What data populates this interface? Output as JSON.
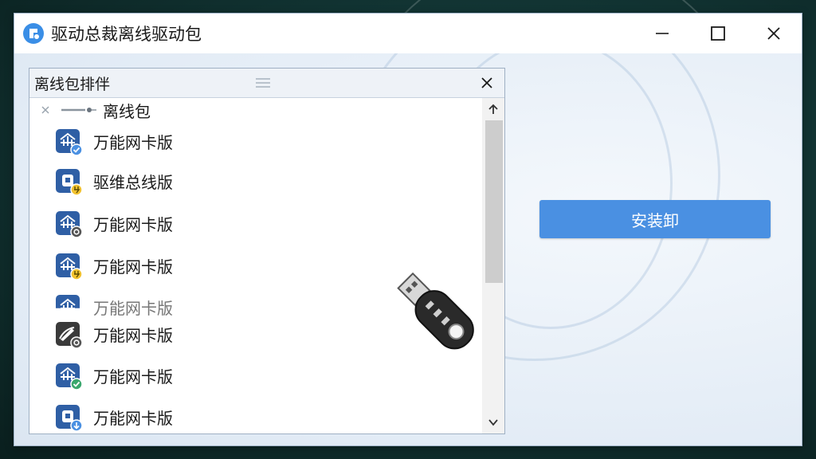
{
  "window": {
    "title": "驱动总裁离线驱动包",
    "controls": [
      "minimize",
      "maximize",
      "close"
    ]
  },
  "panel": {
    "title": "离线包排伴",
    "root_label": "离线包",
    "items": [
      {
        "label": "万能网卡版",
        "icon": "network-card-icon",
        "badge": "check-badge",
        "badge_color": "#4a90e2"
      },
      {
        "label": "驱维总线版",
        "icon": "driver-icon",
        "badge": "plug-badge",
        "badge_color": "#f2c230"
      },
      {
        "label": "万能网卡版",
        "icon": "network-card-icon",
        "badge": "gear-badge",
        "badge_color": "#555555"
      },
      {
        "label": "万能网卡版",
        "icon": "network-card-icon",
        "badge": "plug-badge",
        "badge_color": "#f2c230"
      },
      {
        "label": "万能网卡版",
        "icon": "network-card-icon",
        "badge": "",
        "badge_color": ""
      },
      {
        "label": "万能网卡版",
        "icon": "pen-icon",
        "badge": "gear-badge",
        "badge_color": "#555555"
      },
      {
        "label": "万能网卡版",
        "icon": "network-card-icon",
        "badge": "check-badge",
        "badge_color": "#3aa76d"
      },
      {
        "label": "万能网卡版",
        "icon": "driver-icon",
        "badge": "download-badge",
        "badge_color": "#4a90e2"
      }
    ]
  },
  "actions": {
    "install_label": "安装卸"
  },
  "colors": {
    "accent": "#4a90e2",
    "icon_blue": "#2f5fa5"
  }
}
